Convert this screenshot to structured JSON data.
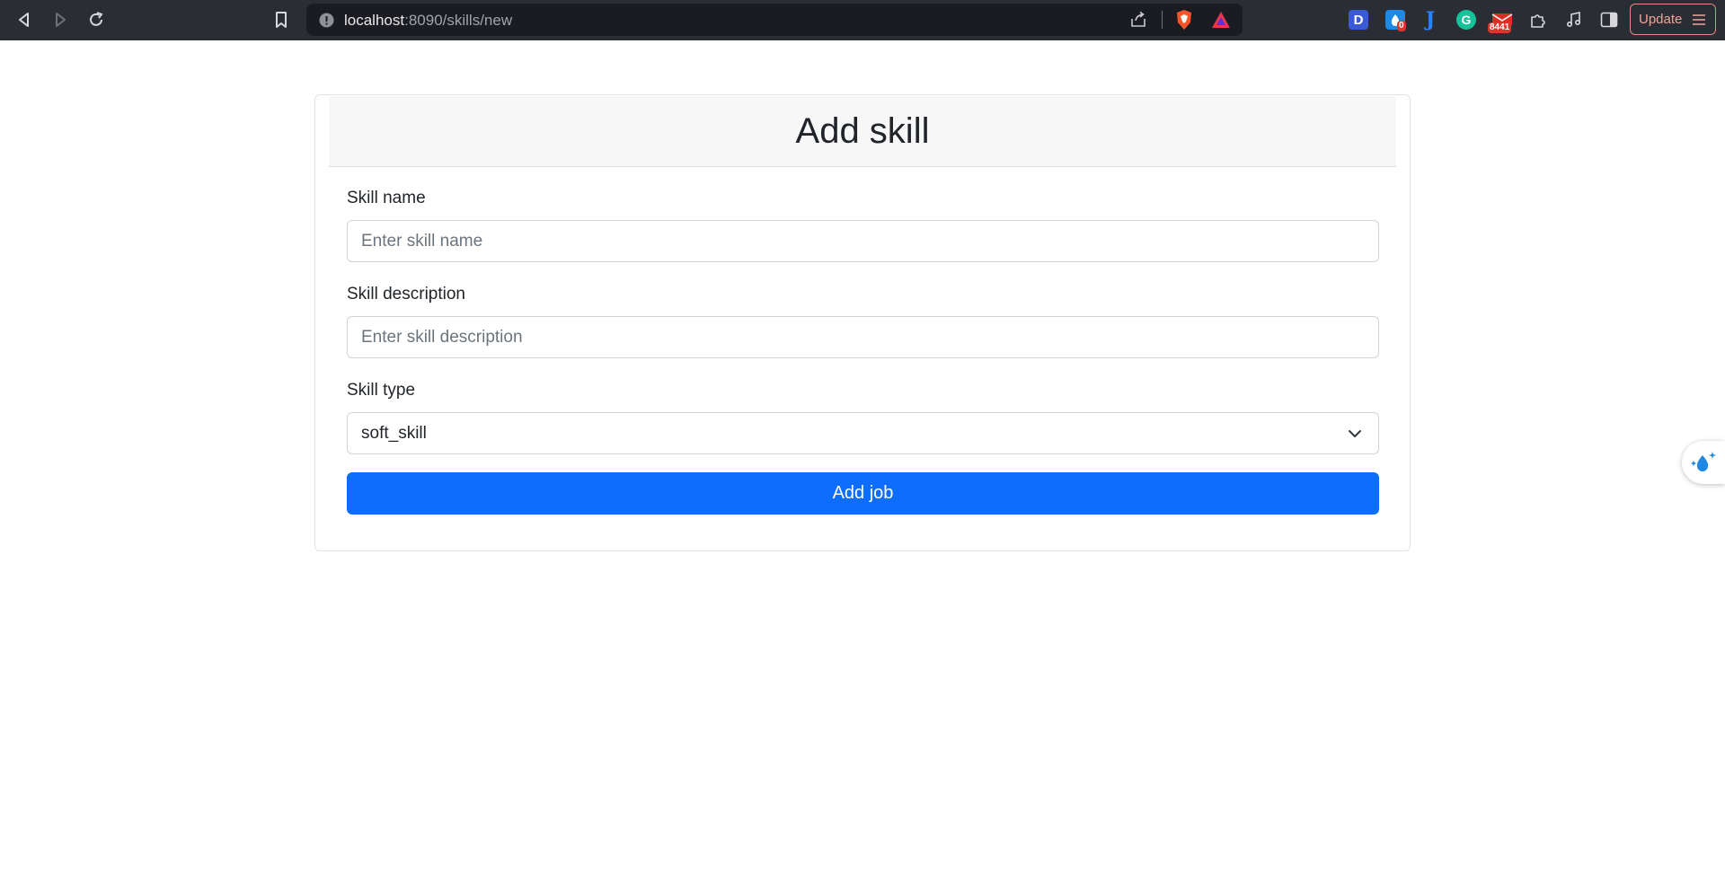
{
  "browser": {
    "url_host": "localhost",
    "url_rest": ":8090/skills/new",
    "update_label": "Update",
    "extensions": [
      {
        "name": "dashlane",
        "letter": "D",
        "color": "#3b5bd6"
      },
      {
        "name": "water-reminder",
        "badge": "0",
        "color": "#1e88e5"
      },
      {
        "name": "jira",
        "letter": "J",
        "color": "#2684ff"
      },
      {
        "name": "grammarly",
        "letter": "G",
        "color": "#15c39a"
      },
      {
        "name": "mail-checker",
        "badge": "8441",
        "color": "#d93025"
      }
    ]
  },
  "form": {
    "title": "Add skill",
    "skill_name_label": "Skill name",
    "skill_name_placeholder": "Enter skill name",
    "skill_description_label": "Skill description",
    "skill_description_placeholder": "Enter skill description",
    "skill_type_label": "Skill type",
    "skill_type_value": "soft_skill",
    "submit_label": "Add job"
  },
  "colors": {
    "primary": "#0d6efd",
    "toolbar": "#2b2d35"
  }
}
